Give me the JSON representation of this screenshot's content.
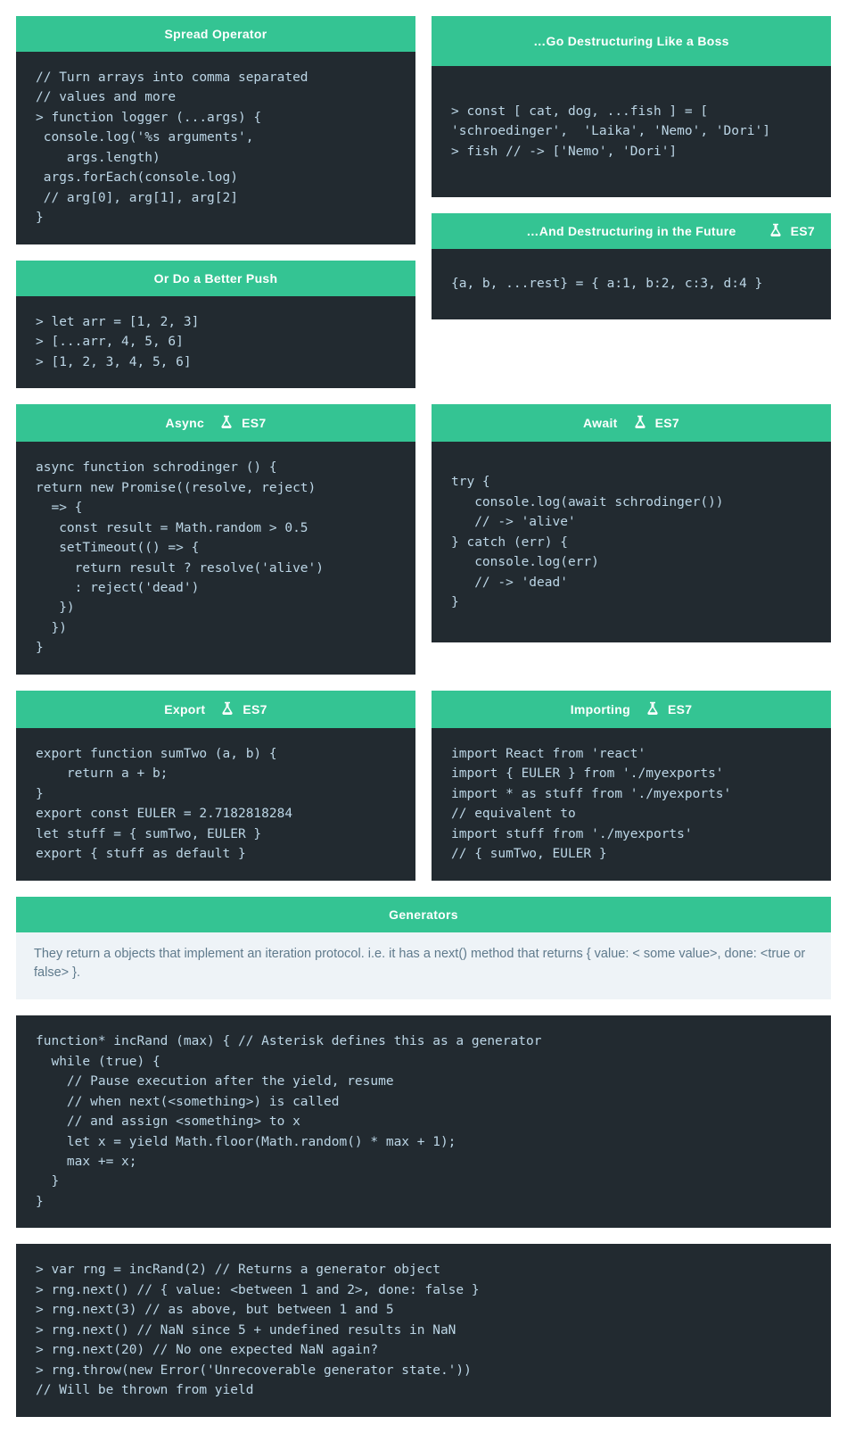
{
  "spread": {
    "title": "Spread Operator",
    "code": "// Turn arrays into comma separated\n// values and more\n> function logger (...args) {\n console.log('%s arguments',\n    args.length)\n args.forEach(console.log)\n // arg[0], arg[1], arg[2]\n}"
  },
  "push": {
    "title": "Or Do a Better Push",
    "code": "> let arr = [1, 2, 3]\n> [...arr, 4, 5, 6]\n> [1, 2, 3, 4, 5, 6]"
  },
  "destruct": {
    "title": "…Go Destructuring Like a Boss",
    "code": "> const [ cat, dog, ...fish ] = [\n'schroedinger',  'Laika', 'Nemo', 'Dori']\n> fish // -> ['Nemo', 'Dori']"
  },
  "destruct_future": {
    "title": "…And Destructuring in the Future",
    "badge": "ES7",
    "code": "{a, b, ...rest} = { a:1, b:2, c:3, d:4 }"
  },
  "async_card": {
    "title": "Async",
    "badge": "ES7",
    "code": "async function schrodinger () {\nreturn new Promise((resolve, reject)\n  => {\n   const result = Math.random > 0.5\n   setTimeout(() => {\n     return result ? resolve('alive')\n     : reject('dead')\n   })\n  })\n}"
  },
  "await_card": {
    "title": "Await",
    "badge": "ES7",
    "code": "try {\n   console.log(await schrodinger())\n   // -> 'alive'\n} catch (err) {\n   console.log(err)\n   // -> 'dead'\n}"
  },
  "export_card": {
    "title": "Export",
    "badge": "ES7",
    "code": "export function sumTwo (a, b) {\n    return a + b;\n}\nexport const EULER = 2.7182818284\nlet stuff = { sumTwo, EULER }\nexport { stuff as default }"
  },
  "import_card": {
    "title": "Importing",
    "badge": "ES7",
    "code": "import React from 'react'\nimport { EULER } from './myexports'\nimport * as stuff from './myexports'\n// equivalent to\nimport stuff from './myexports'\n// { sumTwo, EULER }"
  },
  "generators": {
    "title": "Generators",
    "note": "They return a objects that implement an iteration protocol. i.e. it has a next() method that returns { value: < some value>, done: <true or false> }.",
    "code1": "function* incRand (max) { // Asterisk defines this as a generator\n  while (true) {\n    // Pause execution after the yield, resume\n    // when next(<something>) is called\n    // and assign <something> to x\n    let x = yield Math.floor(Math.random() * max + 1);\n    max += x;\n  }\n}",
    "code2": "> var rng = incRand(2) // Returns a generator object\n> rng.next() // { value: <between 1 and 2>, done: false }\n> rng.next(3) // as above, but between 1 and 5\n> rng.next() // NaN since 5 + undefined results in NaN\n> rng.next(20) // No one expected NaN again?\n> rng.throw(new Error('Unrecoverable generator state.'))\n// Will be thrown from yield"
  }
}
